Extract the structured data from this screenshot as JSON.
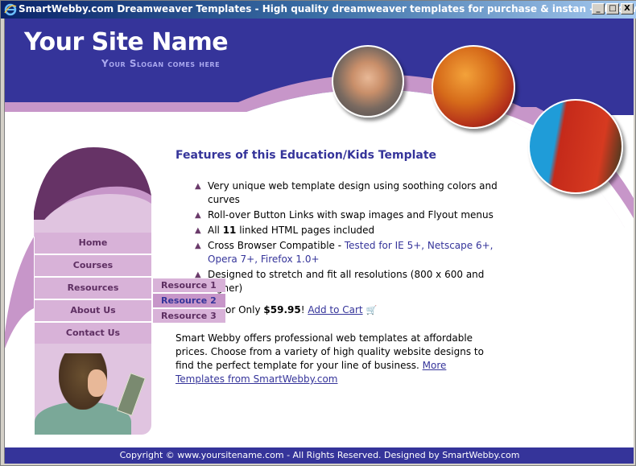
{
  "window": {
    "title": "SmartWebby.com Dreamweaver Templates - High quality dreamweaver templates for purchase & instan - Windows Interne...",
    "controls": {
      "minimize": "_",
      "maximize": "□",
      "close": "X"
    }
  },
  "header": {
    "site_name": "Your Site Name",
    "slogan": "Your Slogan comes here"
  },
  "colors": {
    "header_bg": "#35349a",
    "accent_lilac": "#c796c9",
    "nav_bg": "#d8b2d8",
    "nav_text": "#5e2f62",
    "heading": "#35349a"
  },
  "nav": {
    "items": [
      {
        "label": "Home"
      },
      {
        "label": "Courses"
      },
      {
        "label": "Resources"
      },
      {
        "label": "About Us"
      },
      {
        "label": "Contact Us"
      }
    ],
    "flyout": [
      {
        "label": "Resource 1"
      },
      {
        "label": "Resource 2"
      },
      {
        "label": "Resource 3"
      }
    ]
  },
  "main": {
    "heading": "Features of this Education/Kids Template",
    "features": [
      {
        "text": "Very unique web template design using soothing colors and curves"
      },
      {
        "text": "Roll-over Button Links with swap images and Flyout menus"
      },
      {
        "pre": "All ",
        "bold": "11",
        "post": " linked HTML pages included"
      },
      {
        "pre": "Cross Browser Compatible - ",
        "link": "Tested for IE 5+, Netscape 6+, Opera 7+, Firefox 1.0+"
      },
      {
        "text": "Designed to stretch and fit all resolutions (800 x 600 and higher)"
      }
    ],
    "price_line": {
      "pre": "or Only ",
      "price": "$59.95",
      "post": "! ",
      "cart_link": "Add to Cart"
    },
    "paragraph": "Smart Webby offers professional web templates at affordable prices. Choose from a variety of high quality website designs to find the perfect template for your line of business. ",
    "paragraph_link": "More Templates from SmartWebby.com"
  },
  "footer": {
    "text": "Copyright © www.yoursitename.com - All Rights Reserved. Designed by SmartWebby.com"
  }
}
